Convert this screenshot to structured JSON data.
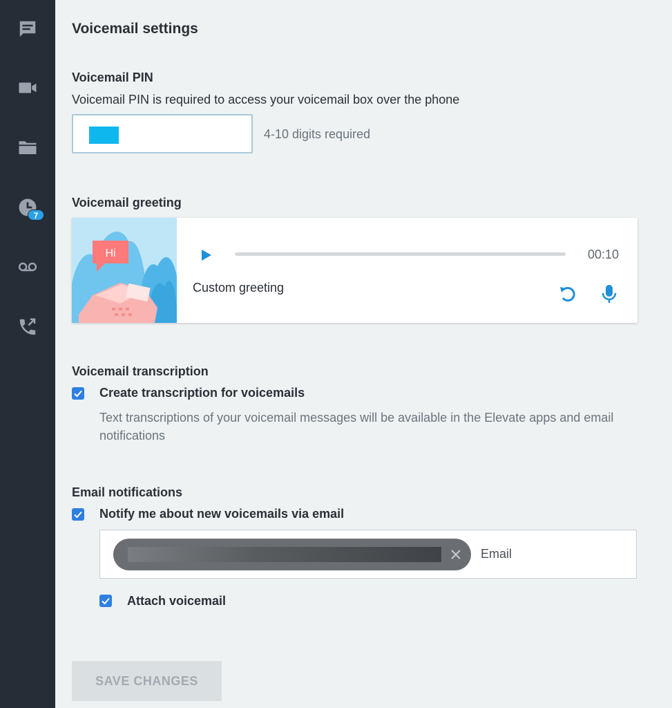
{
  "sidebar": {
    "items": [
      {
        "icon": "chat-icon"
      },
      {
        "icon": "video-icon"
      },
      {
        "icon": "folder-icon"
      },
      {
        "icon": "history-icon",
        "badge": "7"
      },
      {
        "icon": "voicemail-icon"
      },
      {
        "icon": "call-forward-icon"
      }
    ]
  },
  "page": {
    "title": "Voicemail settings"
  },
  "pin": {
    "title": "Voicemail PIN",
    "description": "Voicemail PIN is required to access your voicemail box over the phone",
    "hint": "4-10 digits required"
  },
  "greeting": {
    "title": "Voicemail greeting",
    "bubble_text": "Hi",
    "name": "Custom greeting",
    "duration": "00:10",
    "progress": 0
  },
  "transcription": {
    "title": "Voicemail transcription",
    "checkbox_label": "Create transcription for voicemails",
    "checked": true,
    "description": "Text transcriptions of your voicemail messages will be available in the Elevate apps and email notifications"
  },
  "email": {
    "title": "Email notifications",
    "checkbox_label": "Notify me about new voicemails via email",
    "checked": true,
    "placeholder": "Email",
    "attach_label": "Attach voicemail",
    "attach_checked": true
  },
  "actions": {
    "save_label": "SAVE CHANGES"
  },
  "colors": {
    "accent": "#2aa0e6",
    "sidebar": "#262d37",
    "checkbox": "#2f7fe0"
  }
}
